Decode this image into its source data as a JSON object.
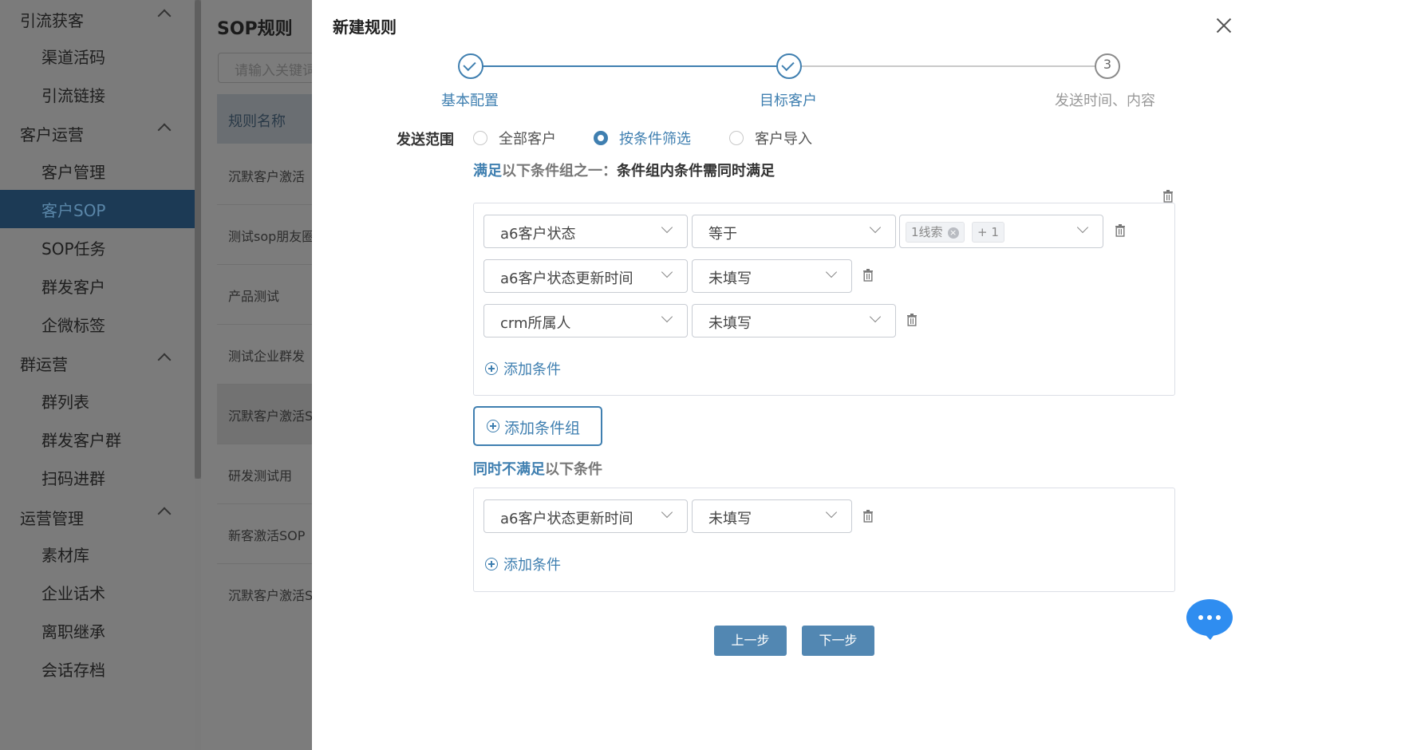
{
  "sidebar": {
    "groups": [
      {
        "label": "引流获客",
        "items": [
          "渠道活码",
          "引流链接"
        ]
      },
      {
        "label": "客户运营",
        "items": [
          "客户管理",
          "客户SOP",
          "SOP任务",
          "群发客户",
          "企微标签"
        ]
      },
      {
        "label": "群运营",
        "items": [
          "群列表",
          "群发客户群",
          "扫码进群"
        ]
      },
      {
        "label": "运营管理",
        "items": [
          "素材库",
          "企业话术",
          "离职继承",
          "会话存档"
        ]
      }
    ],
    "active_item": "客户SOP"
  },
  "list_page": {
    "title": "SOP规则",
    "search_placeholder": "请输入关键词",
    "column_header": "规则名称",
    "rows": [
      "沉默客户激活",
      "测试sop朋友圈",
      "产品测试",
      "测试企业群发",
      "沉默客户激活S",
      "研发测试用",
      "新客激活SOP",
      "沉默客户激活S"
    ]
  },
  "drawer": {
    "title": "新建规则",
    "steps": [
      {
        "label": "基本配置",
        "status": "done"
      },
      {
        "label": "目标客户",
        "status": "done"
      },
      {
        "label": "发送时间、内容",
        "status": "todo",
        "number": "3"
      }
    ],
    "range": {
      "label": "发送范围",
      "options": [
        "全部客户",
        "按条件筛选",
        "客户导入"
      ],
      "selected": "按条件筛选"
    },
    "satisfy_title": {
      "a": "满足",
      "b": "以下条件组之一：",
      "c": "条件组内条件需同时满足"
    },
    "group1": {
      "conditions": [
        {
          "field": "a6客户状态",
          "op": "等于",
          "values": [
            "1线索",
            "+ 1"
          ]
        },
        {
          "field": "a6客户状态更新时间",
          "op": "未填写"
        },
        {
          "field": "crm所属人",
          "op": "未填写"
        }
      ],
      "add_condition": "添加条件"
    },
    "add_group": "添加条件组",
    "exclude_title": {
      "a": "同时不满足",
      "b": "以下条件"
    },
    "exclude_group": {
      "conditions": [
        {
          "field": "a6客户状态更新时间",
          "op": "未填写"
        }
      ],
      "add_condition": "添加条件"
    },
    "buttons": {
      "prev": "上一步",
      "next": "下一步"
    }
  },
  "colors": {
    "primary": "#3f7fb0",
    "button": "#5287b2",
    "chat": "#2f8df0"
  }
}
